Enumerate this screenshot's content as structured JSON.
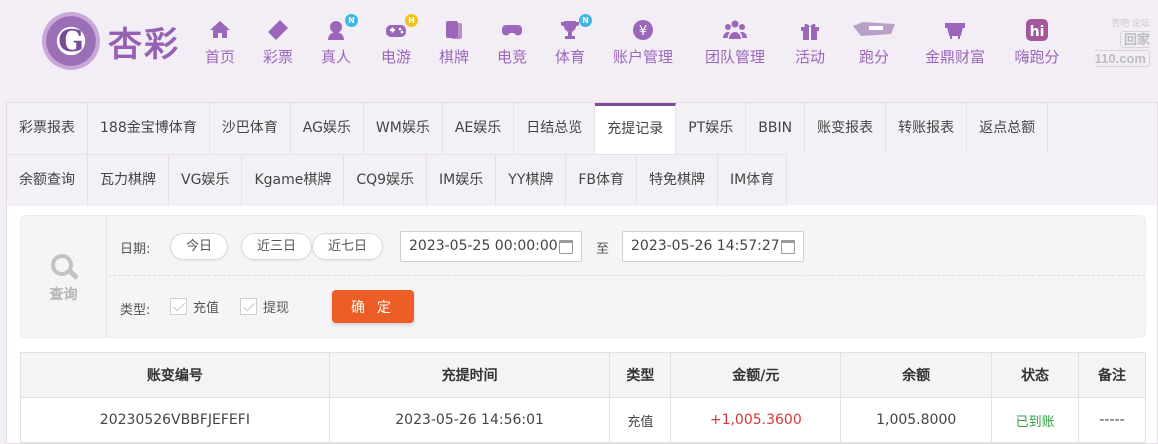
{
  "brand": {
    "logo_char": "G",
    "name": "杏彩"
  },
  "nav": [
    {
      "label": "首页",
      "icon": "home-icon",
      "badge": ""
    },
    {
      "label": "彩票",
      "icon": "ticket-icon",
      "badge": ""
    },
    {
      "label": "真人",
      "icon": "dealer-icon",
      "badge": "N"
    },
    {
      "label": "电游",
      "icon": "gamepad-icon",
      "badge": "H"
    },
    {
      "label": "棋牌",
      "icon": "cards-icon",
      "badge": ""
    },
    {
      "label": "电竞",
      "icon": "controller-icon",
      "badge": ""
    },
    {
      "label": "体育",
      "icon": "trophy-icon",
      "badge": "N"
    },
    {
      "label": "账户管理",
      "icon": "yen-coin-icon",
      "badge": ""
    },
    {
      "label": "团队管理",
      "icon": "team-icon",
      "badge": ""
    },
    {
      "label": "活动",
      "icon": "gift-icon",
      "badge": ""
    },
    {
      "label": "跑分",
      "icon": "running-banner-icon",
      "badge": ""
    },
    {
      "label": "金鼎财富",
      "icon": "ding-icon",
      "badge": ""
    },
    {
      "label": "嗨跑分",
      "icon": "hi-app-icon",
      "badge": ""
    }
  ],
  "watermark": {
    "top": "杏吧 论坛",
    "site": "回家110.com"
  },
  "tabs_row1": [
    "彩票报表",
    "188金宝博体育",
    "沙巴体育",
    "AG娱乐",
    "WM娱乐",
    "AE娱乐",
    "日结总览",
    "充提记录",
    "PT娱乐",
    "BBIN",
    "账变报表",
    "转账报表",
    "返点总额"
  ],
  "tabs_row2": [
    "余额查询",
    "瓦力棋牌",
    "VG娱乐",
    "Kgame棋牌",
    "CQ9娱乐",
    "IM娱乐",
    "YY棋牌",
    "FB体育",
    "特免棋牌",
    "IM体育"
  ],
  "active_tab": "充提记录",
  "filter": {
    "query_label": "查询",
    "date_label": "日期:",
    "quick_dates": [
      "今日",
      "近三日",
      "近七日"
    ],
    "start_date": "2023-05-25 00:00:00",
    "to_label": "至",
    "end_date": "2023-05-26 14:57:27",
    "type_label": "类型:",
    "types": [
      "充值",
      "提现"
    ],
    "confirm_label": "确 定"
  },
  "table": {
    "headers": [
      "账变编号",
      "充提时间",
      "类型",
      "金额/元",
      "余额",
      "状态",
      "备注"
    ],
    "rows": [
      [
        "20230526VBBFJEFEFI",
        "2023-05-26 14:56:01",
        "充值",
        "+1,005.3600",
        "1,005.8000",
        "已到账",
        "-----"
      ]
    ]
  },
  "colors": {
    "brand_purple": "#9b67ba",
    "active_tab_border": "#7d4c99",
    "confirm_button": "#ec5e26",
    "amount_positive": "#d9363e",
    "status_success": "#2ea043",
    "badge_n": "#3db6e6",
    "badge_h": "#f2c21b"
  }
}
